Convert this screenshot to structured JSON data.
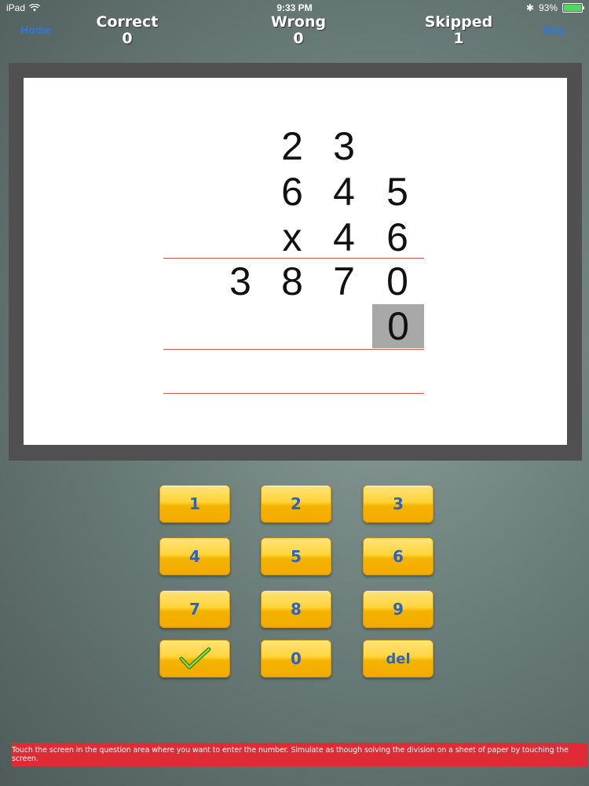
{
  "status_bar": {
    "device": "iPad",
    "time": "9:33 PM",
    "battery": "93%"
  },
  "header": {
    "home_label": "Home",
    "skip_label": "Skip",
    "correct_label": "Correct",
    "correct_count": "0",
    "wrong_label": "Wrong",
    "wrong_count": "0",
    "skipped_label": "Skipped",
    "skipped_count": "1"
  },
  "problem": {
    "carry": [
      "2",
      "3"
    ],
    "multiplicand": [
      "6",
      "4",
      "5"
    ],
    "operator": "x",
    "multiplier": [
      "4",
      "6"
    ],
    "partial_1": [
      "3",
      "8",
      "7",
      "0"
    ],
    "partial_2_entered": "0"
  },
  "keypad": {
    "k1": "1",
    "k2": "2",
    "k3": "3",
    "k4": "4",
    "k5": "5",
    "k6": "6",
    "k7": "7",
    "k8": "8",
    "k9": "9",
    "k0": "0",
    "del": "del",
    "check_icon": "checkmark-icon"
  },
  "hint": "Touch the screen in the question area where you want to enter the number. Simulate as though solving the division on a sheet of paper by touching the screen."
}
